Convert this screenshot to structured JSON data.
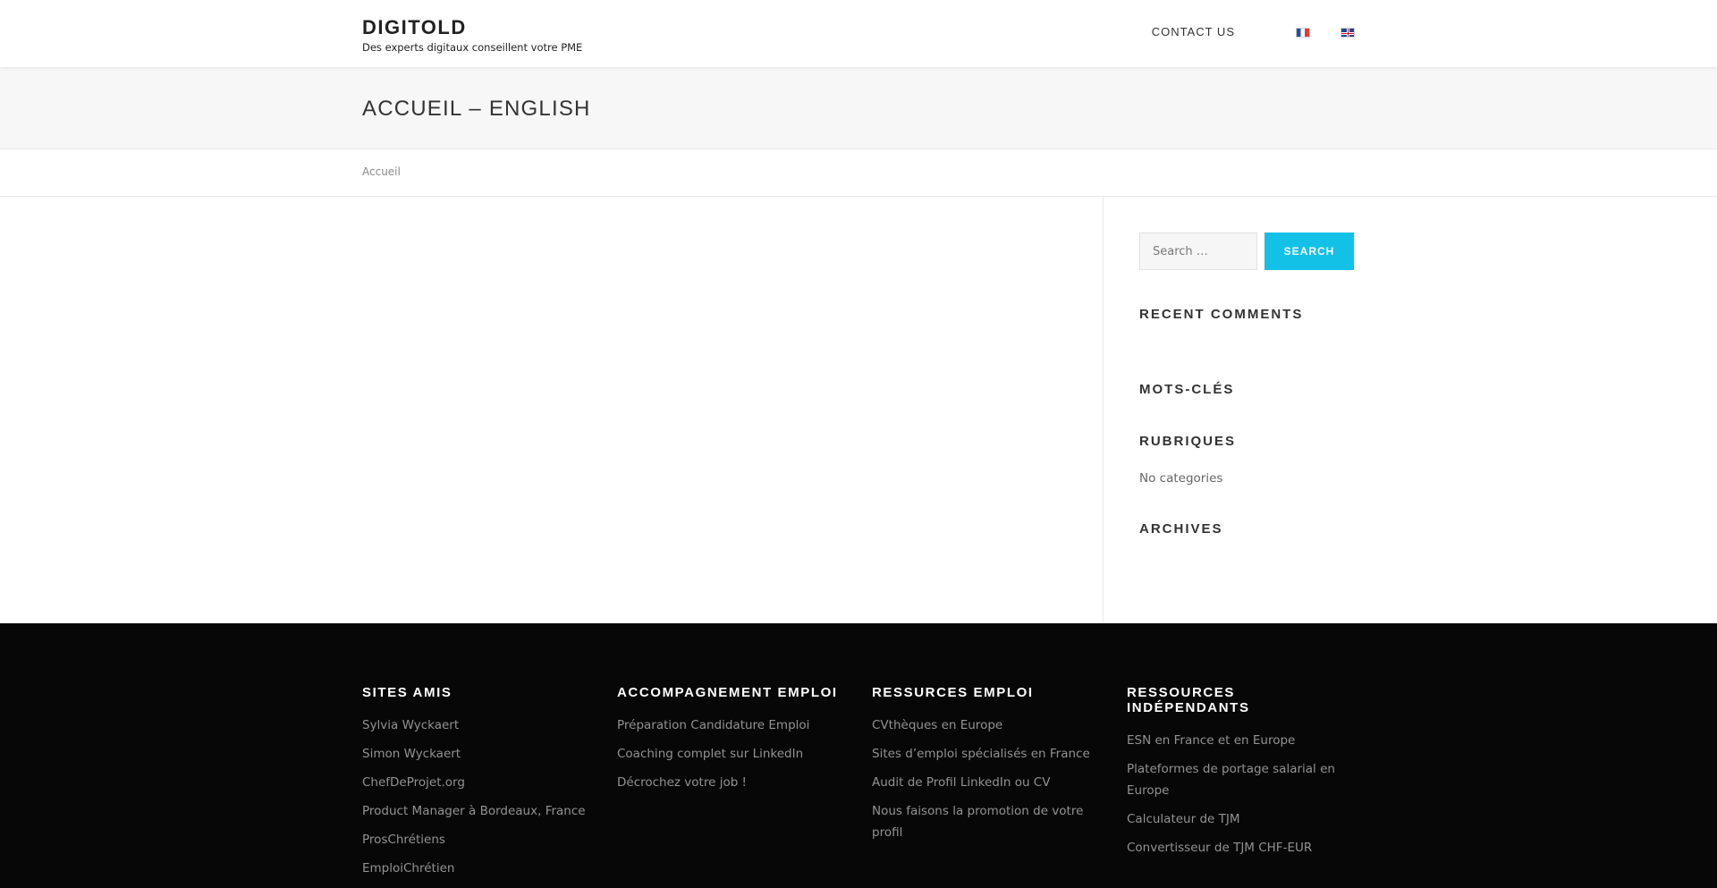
{
  "header": {
    "site_title": "DIGITOLD",
    "tagline": "Des experts digitaux conseillent votre PME",
    "nav": {
      "contact_label": "CONTACT US"
    },
    "languages": [
      "fr-flag-icon",
      "en-flag-icon"
    ]
  },
  "page": {
    "title": "ACCUEIL – ENGLISH",
    "breadcrumb": "Accueil"
  },
  "sidebar": {
    "search": {
      "placeholder": "Search …",
      "button_label": "SEARCH"
    },
    "recent_comments_title": "RECENT COMMENTS",
    "tags_title": "MOTS-CLÉS",
    "categories_title": "RUBRIQUES",
    "categories_empty": "No categories",
    "archives_title": "ARCHIVES"
  },
  "footer": {
    "columns": [
      {
        "title": "SITES AMIS",
        "links": [
          "Sylvia Wyckaert",
          "Simon Wyckaert",
          "ChefDeProjet.org",
          "Product Manager à Bordeaux, France",
          "ProsChrétiens",
          "EmploiChrétien"
        ]
      },
      {
        "title": "ACCOMPAGNEMENT EMPLOI",
        "links": [
          "Préparation Candidature Emploi",
          "Coaching complet sur LinkedIn",
          "Décrochez votre job !"
        ]
      },
      {
        "title": "RESSURCES EMPLOI",
        "links": [
          "CVthèques en Europe",
          "Sites d’emploi spécialisés en France",
          "Audit de Profil LinkedIn ou CV",
          "Nous faisons la promotion de votre profil"
        ]
      },
      {
        "title": "RESSOURCES INDÉPENDANTS",
        "links": [
          "ESN en France et en Europe",
          "Plateformes de portage salarial en Europe",
          "Calculateur de TJM",
          "Convertisseur de TJM CHF-EUR"
        ]
      }
    ]
  },
  "colors": {
    "accent": "#13c1e6",
    "footer_bg": "#070707"
  }
}
